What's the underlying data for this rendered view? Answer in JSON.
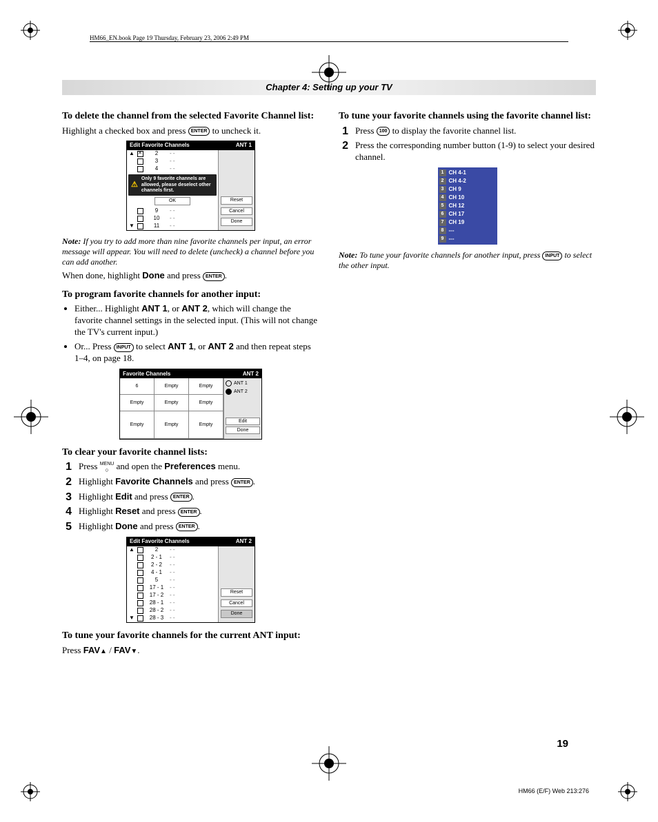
{
  "meta": {
    "running_header": "HM66_EN.book  Page 19  Thursday, February 23, 2006  2:49 PM",
    "chapter": "Chapter 4: Setting up your TV",
    "page_number": "19",
    "footer_code": "HM66 (E/F) Web 213:276"
  },
  "buttons": {
    "enter": "ENTER",
    "input": "INPUT",
    "hundred": "100",
    "menu_label": "MENU"
  },
  "left": {
    "h_delete": "To delete the channel from the selected Favorite Channel list:",
    "delete_body": "Highlight a checked box and press ",
    "delete_body2": " to uncheck it.",
    "note1": "If you try to add more than nine favorite channels per input, an error message will appear. You will need to delete (uncheck) a channel before you can add another.",
    "when_done_a": "When done, highlight ",
    "when_done_b": "Done",
    "when_done_c": " and press ",
    "h_program": "To program favorite channels for another input:",
    "bul1_a": "Either... Highlight ",
    "bul1_b": "ANT 1",
    "bul1_c": ", or ",
    "bul1_d": "ANT 2",
    "bul1_e": ", which will change the favorite channel settings in the selected input. (This will not change the TV's current input.)",
    "bul2_a": "Or... Press ",
    "bul2_b": " to select ",
    "bul2_c": "ANT 1",
    "bul2_d": ", or ",
    "bul2_e": "ANT 2",
    "bul2_f": " and then repeat steps 1–4, on page 18.",
    "h_clear": "To clear your favorite channel lists:",
    "clear1_a": "Press ",
    "clear1_b": " and open the ",
    "clear1_c": "Preferences",
    "clear1_d": " menu.",
    "clear2_a": "Highlight ",
    "clear2_b": "Favorite Channels",
    "clear2_c": " and press ",
    "clear3_a": "Highlight ",
    "clear3_b": "Edit",
    "clear3_c": " and press ",
    "clear4_a": "Highlight ",
    "clear4_b": "Reset",
    "clear4_c": " and press ",
    "clear5_a": "Highlight ",
    "clear5_b": "Done",
    "clear5_c": " and press ",
    "h_tune_ant": "To tune your favorite channels for the current ANT input:",
    "press_fav_a": "Press ",
    "press_fav_b": "FAV",
    "press_fav_c": " / ",
    "press_fav_d": "FAV",
    "press_fav_e": "."
  },
  "right": {
    "h_tune_list": "To tune your favorite channels using the favorite channel list:",
    "step1_a": "Press ",
    "step1_b": " to display the favorite channel list.",
    "step2": "Press the corresponding number button (1-9) to select your desired channel.",
    "note2_a": "To tune your favorite channels for another input, press ",
    "note2_b": " to select the other input."
  },
  "fig1": {
    "title": "Edit Favorite Channels",
    "ant": "ANT 1",
    "top_rows": [
      {
        "arrow": "▲",
        "checked": true,
        "num": "2"
      },
      {
        "arrow": "",
        "checked": false,
        "num": "3"
      },
      {
        "arrow": "",
        "checked": false,
        "num": "4"
      }
    ],
    "warn": "Only 9 favorite channels are allowed, please deselect other channels first.",
    "ok": "OK",
    "bottom_rows": [
      {
        "arrow": "",
        "checked": false,
        "num": "9"
      },
      {
        "arrow": "",
        "checked": false,
        "num": "10"
      },
      {
        "arrow": "▼",
        "checked": false,
        "num": "11"
      }
    ],
    "side": [
      "Reset",
      "Cancel",
      "Done"
    ]
  },
  "fig2": {
    "title": "Favorite Channels",
    "ant": "ANT 2",
    "cells": [
      "6",
      "Empty",
      "Empty",
      "Empty",
      "Empty",
      "Empty",
      "Empty",
      "Empty",
      "Empty"
    ],
    "radios": [
      {
        "label": "ANT 1",
        "sel": false
      },
      {
        "label": "ANT 2",
        "sel": true
      }
    ],
    "side": [
      "Edit",
      "Done"
    ]
  },
  "fig3": {
    "title": "Edit Favorite Channels",
    "ant": "ANT 2",
    "rows": [
      {
        "arrow": "▲",
        "num": "2"
      },
      {
        "arrow": "",
        "num": "2 - 1"
      },
      {
        "arrow": "",
        "num": "2 - 2"
      },
      {
        "arrow": "",
        "num": "4 - 1"
      },
      {
        "arrow": "",
        "num": "5"
      },
      {
        "arrow": "",
        "num": "17 - 1"
      },
      {
        "arrow": "",
        "num": "17 - 2"
      },
      {
        "arrow": "",
        "num": "28 - 1"
      },
      {
        "arrow": "",
        "num": "28 - 2"
      },
      {
        "arrow": "▼",
        "num": "28 - 3"
      }
    ],
    "side": [
      "Reset",
      "Cancel",
      "Done"
    ],
    "side_selected": "Done"
  },
  "favlist": {
    "items": [
      "CH 4-1",
      "CH 4-2",
      "CH 9",
      "CH 10",
      "CH 12",
      "CH 17",
      "CH 19",
      "---",
      "---"
    ]
  }
}
